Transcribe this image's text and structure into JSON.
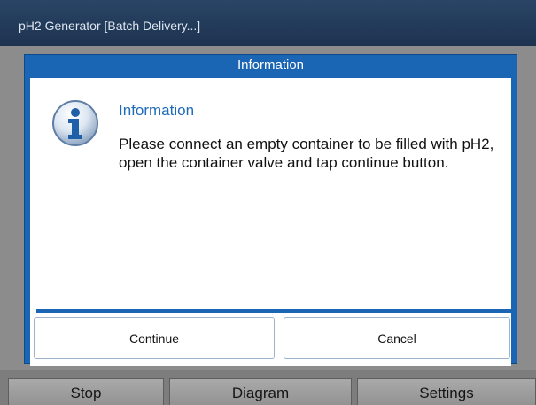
{
  "window": {
    "title": "pH2 Generator  [Batch Delivery...]"
  },
  "dialog": {
    "header": "Information",
    "icon": "info-icon",
    "message_title": "Information",
    "message": "Please connect an empty container to be filled with pH2, open the container valve and tap continue button.",
    "buttons": {
      "continue": "Continue",
      "cancel": "Cancel"
    },
    "accent_color": "#1a65b4"
  },
  "bottom_tabs": [
    {
      "label": "Stop"
    },
    {
      "label": "Diagram"
    },
    {
      "label": "Settings"
    }
  ]
}
